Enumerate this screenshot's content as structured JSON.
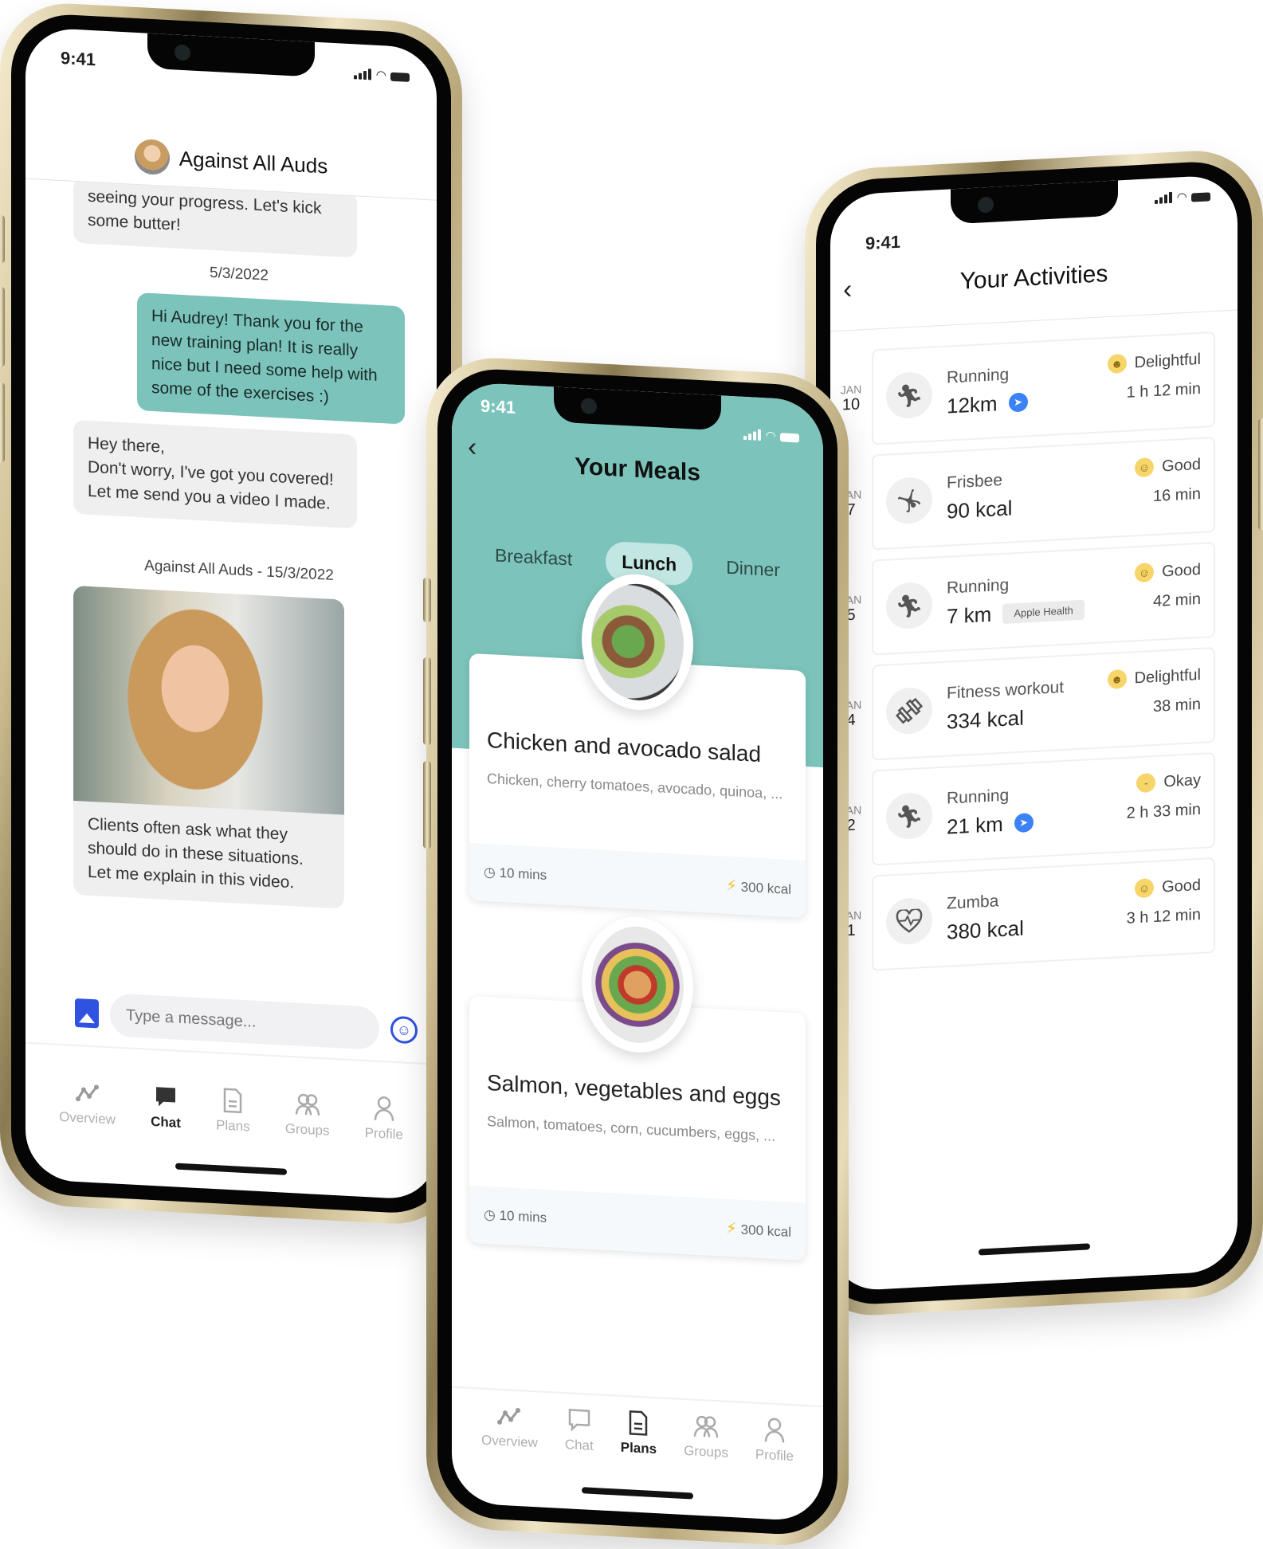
{
  "status_bar": {
    "time": "9:41"
  },
  "chat_screen": {
    "contact_name": "Against All Auds",
    "messages": [
      {
        "direction": "incoming",
        "text": "seeing your progress. Let's kick some butter!"
      },
      {
        "type": "date",
        "text": "5/3/2022"
      },
      {
        "direction": "outgoing",
        "text": "Hi Audrey! Thank you for the new training plan! It is really nice but I need some help with some of the exercises :)"
      },
      {
        "direction": "incoming",
        "text": "Hey there,\nDon't worry, I've got you covered!\nLet me send you a video I made."
      },
      {
        "type": "date",
        "text": "Against All Auds - 15/3/2022"
      },
      {
        "direction": "incoming",
        "type": "video",
        "caption": "Clients often ask what they should do in these situations. Let me explain in this video."
      }
    ],
    "composer": {
      "placeholder": "Type a message..."
    },
    "accent_color": "#2f52e0",
    "outgoing_bubble_color": "#7cc4bb"
  },
  "meals_screen": {
    "title": "Your Meals",
    "tabs": [
      {
        "label": "Breakfast",
        "active": false
      },
      {
        "label": "Lunch",
        "active": true
      },
      {
        "label": "Dinner",
        "active": false
      }
    ],
    "meals": [
      {
        "name": "Chicken and avocado salad",
        "ingredients": "Chicken, cherry tomatoes, avocado, quinoa, ...",
        "time": "10 mins",
        "calories": "300 kcal"
      },
      {
        "name": "Salmon, vegetables and eggs",
        "ingredients": "Salmon, tomatoes, corn, cucumbers, eggs, ...",
        "time": "10 mins",
        "calories": "300 kcal"
      }
    ],
    "header_color": "#7cc4bb"
  },
  "activities_screen": {
    "title": "Your Activities",
    "items": [
      {
        "month": "JAN",
        "day": "10",
        "name": "Running",
        "value": "12km",
        "source": "gps",
        "mood": "Delightful",
        "duration": "1 h 12 min",
        "icon": "running-icon"
      },
      {
        "month": "JAN",
        "day": "7",
        "name": "Frisbee",
        "value": "90 kcal",
        "source": "",
        "mood": "Good",
        "duration": "16 min",
        "icon": "frisbee-icon"
      },
      {
        "month": "JAN",
        "day": "5",
        "name": "Running",
        "value": "7 km",
        "source": "Apple Health",
        "mood": "Good",
        "duration": "42 min",
        "icon": "running-icon"
      },
      {
        "month": "JAN",
        "day": "4",
        "name": "Fitness workout",
        "value": "334 kcal",
        "source": "",
        "mood": "Delightful",
        "duration": "38 min",
        "icon": "dumbbell-icon"
      },
      {
        "month": "JAN",
        "day": "2",
        "name": "Running",
        "value": "21 km",
        "source": "gps",
        "mood": "Okay",
        "duration": "2 h 33 min",
        "icon": "running-icon"
      },
      {
        "month": "JAN",
        "day": "1",
        "name": "Zumba",
        "value": "380 kcal",
        "source": "",
        "mood": "Good",
        "duration": "3 h 12 min",
        "icon": "heart-pulse-icon"
      }
    ]
  },
  "tab_bar": {
    "items": [
      {
        "label": "Overview",
        "icon": "overview-icon"
      },
      {
        "label": "Chat",
        "icon": "chat-icon"
      },
      {
        "label": "Plans",
        "icon": "plans-icon"
      },
      {
        "label": "Groups",
        "icon": "groups-icon"
      },
      {
        "label": "Profile",
        "icon": "profile-icon"
      }
    ],
    "chat_screen_active": "Chat",
    "meals_screen_active": "Plans"
  }
}
